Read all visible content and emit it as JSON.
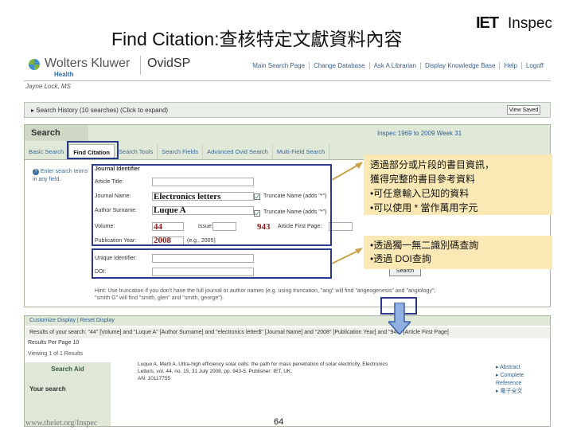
{
  "slide": {
    "title": "Find Citation:查核特定文獻資料內容",
    "page_number": "64",
    "footer_url": "www.theiet.org/Inspec"
  },
  "brand": {
    "iet": "IET",
    "inspec": "Inspec"
  },
  "topbar": {
    "logo_text": "Wolters Kluwer",
    "logo_sub": "Health",
    "product": "OvidSP",
    "nav": [
      "Main Search Page",
      "Change Database",
      "Ask A Librarian",
      "Display Knowledge Base",
      "Help",
      "Logoff"
    ]
  },
  "user_name": "Jayne Lock, MS",
  "search_history": {
    "label": "▸ Search History (10 searches) (Click to expand)",
    "view_saved": "View Saved"
  },
  "search": {
    "tab": "Search",
    "db_info": "Inspec 1969 to 2009 Week 31",
    "tabs": [
      "Basic Search",
      "Find Citation",
      "Search Tools",
      "Search Fields",
      "Advanced Ovid Search",
      "Multi-Field Search"
    ],
    "hint": "Enter search terms in any field.",
    "fields": [
      {
        "label": "Journal Identifier",
        "value": ""
      },
      {
        "label": "Article Title:",
        "value": ""
      },
      {
        "label": "Journal Name:",
        "value": "Electronics letters"
      },
      {
        "label": "Author Surname:",
        "value": "Luque A"
      },
      {
        "label": "Volume:",
        "value": "44"
      },
      {
        "label": "Publication Year:",
        "value": "2008"
      },
      {
        "label": "Unique Identifier:",
        "value": ""
      },
      {
        "label": "DOI:",
        "value": ""
      }
    ],
    "truncate_label": "Truncate Name (adds \"*\")",
    "issue_label": "Issue:",
    "first_page_label": "Article First Page:",
    "first_page_value": "943",
    "year_hint": "(e.g., 2005)",
    "hint_lines": "Hint: Use truncation if you don't have the full journal or author names (e.g. using truncation, \"ang\" will find \"angeogenesis\" and \"angiology\"; \"smith G\" will find \"smith, glen\" and \"smith, george\").",
    "button": "Search"
  },
  "results": {
    "customize": "Customize Display | Reset Display",
    "query": "Results of your search: \"44\" [Volume] and \"Luque A\" [Author Surname] and \"electronics letter$\" [Journal Name] and \"2008\" [Publication Year] and \"943\" [Article First Page]",
    "per_page_label": "Results Per Page",
    "per_page": "10",
    "viewing": "Viewing 1 of 1 Results",
    "search_aid": "Search Aid",
    "your_search": "Your search",
    "citation": "Luque A, Marti A. Ultra-high efficiency solar cells: the path for mass penetration of solar electricity. Electronics Letters, vol. 44, no. 15, 31 July 2008, pp. 943-5. Publisher: IET, UK.",
    "an": "AN: 10117755",
    "links": [
      "Abstract",
      "Complete Reference",
      "電子全文"
    ]
  },
  "annotations": {
    "box1": [
      "透過部分或片段的書目資訊，",
      "獲得完整的書目參考資料",
      "•可任意輸入已知的資料",
      "•可以使用 * 當作萬用字元"
    ],
    "box2": [
      "•透過獨一無二識別碼查詢",
      "•透過 DOI查詢"
    ]
  },
  "colors": {
    "annotation_bg": "#fbe9b5",
    "highlight_border": "#2b3a8c",
    "panel_green": "#e0e8d8"
  }
}
